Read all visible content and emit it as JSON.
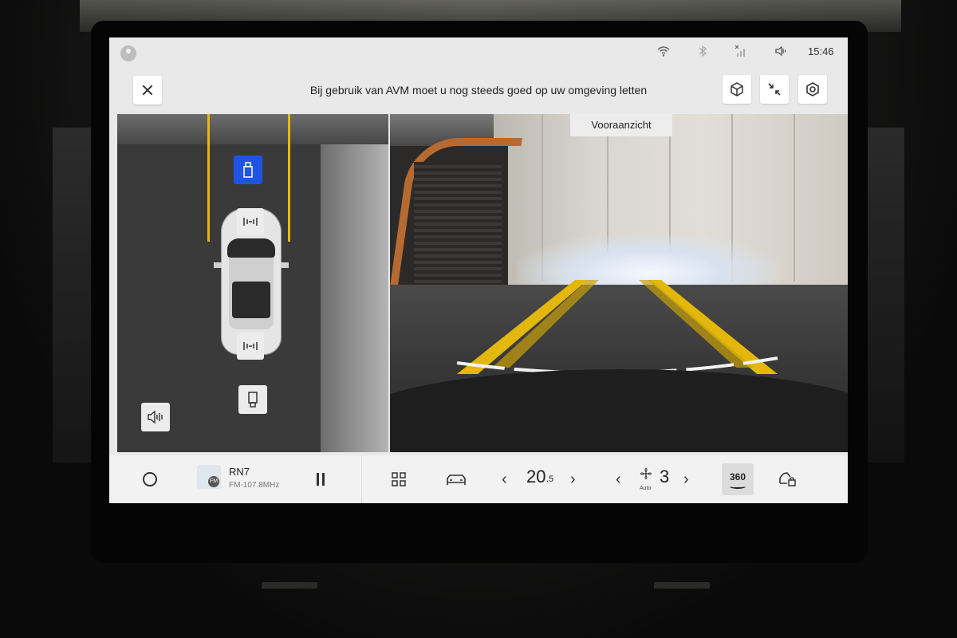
{
  "status_bar": {
    "time": "15:46",
    "icons": [
      "wifi-icon",
      "bluetooth-off-icon",
      "signal-off-icon",
      "volume-icon"
    ]
  },
  "header": {
    "warning_text": "Bij gebruik van AVM moet u nog steeds goed op uw omgeving letten",
    "buttons": [
      "3d-view-icon",
      "minimize-icon",
      "settings-icon"
    ]
  },
  "camera": {
    "view_label": "Vooraanzicht"
  },
  "dock": {
    "station": "RN7",
    "frequency": "FM-107.8MHz",
    "temperature": "20",
    "temperature_decimal": ".5",
    "fan_mode": "Auto",
    "fan_speed": "3",
    "view_button": "360"
  },
  "colors": {
    "active_button": "#1e55e6",
    "guide_line": "#e8b80d",
    "screen_bg": "#e9e9e9"
  }
}
